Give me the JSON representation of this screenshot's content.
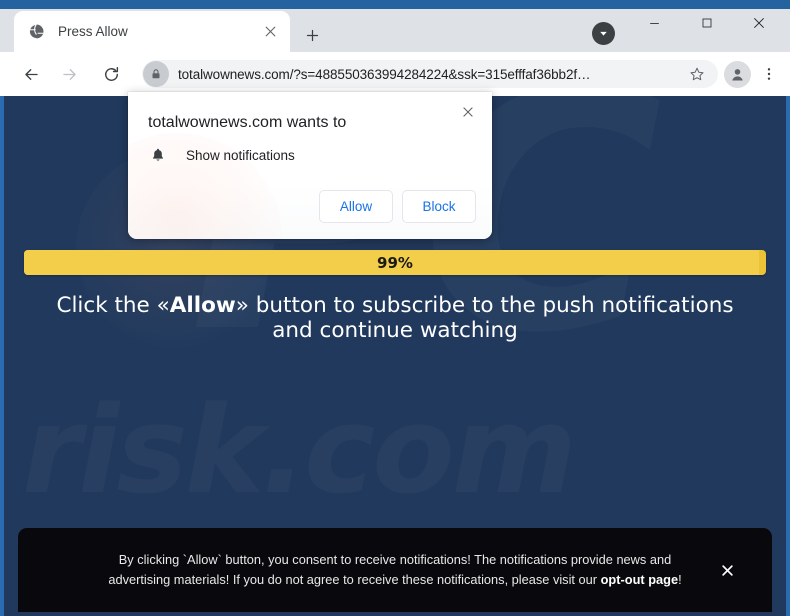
{
  "browser": {
    "tab": {
      "title": "Press Allow",
      "favicon": "globe-icon",
      "close_label": "×"
    },
    "new_tab_label": "+",
    "window_controls": {
      "minimize": "–",
      "maximize": "□",
      "close": "✕"
    },
    "downloads_indicator": "download-chevron-icon",
    "toolbar": {
      "back": "back-arrow-icon",
      "forward": "forward-arrow-icon",
      "reload": "reload-icon",
      "lock": "lock-icon",
      "url": "totalwownews.com/?s=488550363994284224&ssk=315efffaf36bb2f…",
      "url_full": "totalwownews.com/?s=488550363994284224&ssk=315efffaf36bb2f...",
      "bookmark": "star-icon",
      "profile": "profile-avatar-icon",
      "menu": "three-dot-menu-icon"
    }
  },
  "permission_dialog": {
    "title": "totalwownews.com wants to",
    "permission_icon": "bell-icon",
    "permission_label": "Show notifications",
    "allow_label": "Allow",
    "block_label": "Block",
    "close_label": "✕"
  },
  "page": {
    "background_color": "#21395c",
    "watermark_large": "PC",
    "watermark_small": "risk.com",
    "progress": {
      "percent_label": "99%",
      "percent_value": 99,
      "bar_color": "#f2ce4b",
      "track_color": "#ecc337"
    },
    "headline": {
      "part1": "Click the «",
      "bold": "Allow",
      "part2": "» button to subscribe to the push notifications and continue watching"
    }
  },
  "consent_banner": {
    "text_part1": "By clicking `Allow` button, you consent to receive notifications! The notifications provide news and advertising materials! If you do not agree to receive these notifications, please visit our ",
    "link_label": "opt-out page",
    "text_part2": "!",
    "close_label": "✕",
    "background_color": "#09090d"
  }
}
